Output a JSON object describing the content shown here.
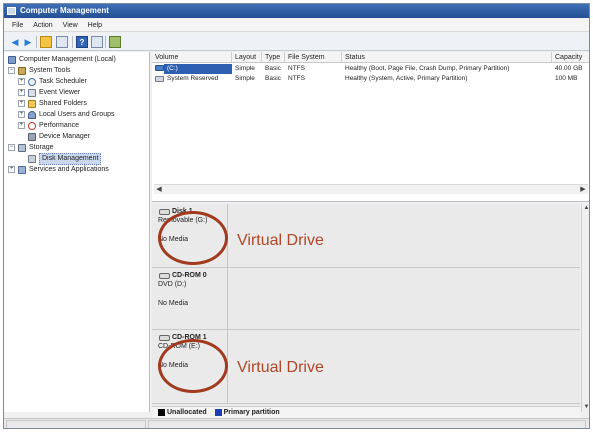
{
  "window": {
    "title": "Computer Management"
  },
  "menu": [
    "File",
    "Action",
    "View",
    "Help"
  ],
  "tree": {
    "root": "Computer Management (Local)",
    "system_tools": "System Tools",
    "task_scheduler": "Task Scheduler",
    "event_viewer": "Event Viewer",
    "shared_folders": "Shared Folders",
    "local_users": "Local Users and Groups",
    "performance": "Performance",
    "device_manager": "Device Manager",
    "storage": "Storage",
    "disk_management": "Disk Management",
    "services": "Services and Applications"
  },
  "volumes": {
    "columns": [
      "Volume",
      "Layout",
      "Type",
      "File System",
      "Status",
      "Capacity"
    ],
    "rows": [
      {
        "volume": "(C:)",
        "layout": "Simple",
        "type": "Basic",
        "fs": "NTFS",
        "status": "Healthy (Boot, Page File, Crash Dump, Primary Partition)",
        "capacity": "40.00 GB"
      },
      {
        "volume": "System Reserved",
        "layout": "Simple",
        "type": "Basic",
        "fs": "NTFS",
        "status": "Healthy (System, Active, Primary Partition)",
        "capacity": "100 MB"
      }
    ]
  },
  "disks": [
    {
      "name": "Disk 1",
      "sub": "Removable (G:)",
      "media": "No Media",
      "annotation": "Virtual Drive"
    },
    {
      "name": "CD-ROM 0",
      "sub": "DVD (D:)",
      "media": "No Media",
      "annotation": ""
    },
    {
      "name": "CD-ROM 1",
      "sub": "CD-ROM (E:)",
      "media": "No Media",
      "annotation": "Virtual Drive"
    }
  ],
  "legend": {
    "unallocated": "Unallocated",
    "primary": "Primary partition",
    "unallocated_color": "#000000",
    "primary_color": "#1f3fb5"
  },
  "colors": {
    "annotation": "#b0472a",
    "circle": "#a13a1e"
  }
}
